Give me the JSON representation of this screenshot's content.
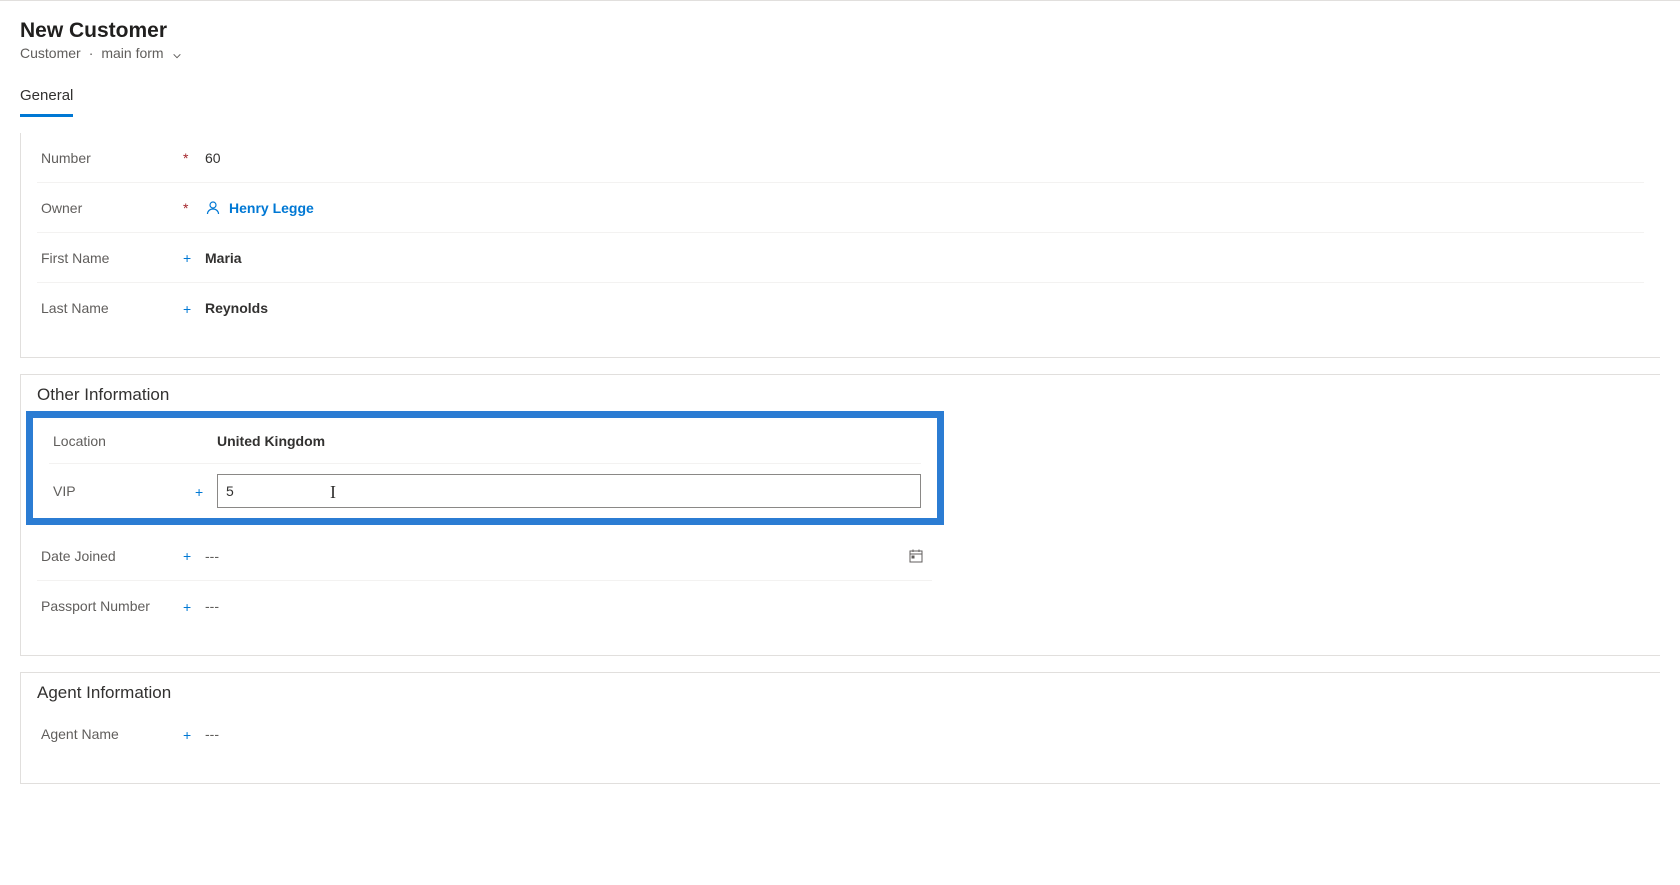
{
  "header": {
    "title": "New Customer",
    "entity": "Customer",
    "form_name": "main form"
  },
  "tabs": {
    "general": "General"
  },
  "fields": {
    "number": {
      "label": "Number",
      "value": "60",
      "required": "red"
    },
    "owner": {
      "label": "Owner",
      "value": "Henry Legge",
      "required": "red"
    },
    "first_name": {
      "label": "First Name",
      "value": "Maria",
      "required": "blue"
    },
    "last_name": {
      "label": "Last Name",
      "value": "Reynolds",
      "required": "blue"
    }
  },
  "sections": {
    "other_info": {
      "title": "Other Information",
      "location": {
        "label": "Location",
        "value": "United Kingdom"
      },
      "vip": {
        "label": "VIP",
        "value": "5",
        "required": "blue"
      },
      "date_joined": {
        "label": "Date Joined",
        "value": "---",
        "required": "blue"
      },
      "passport": {
        "label": "Passport Number",
        "value": "---",
        "required": "blue"
      }
    },
    "agent_info": {
      "title": "Agent Information",
      "agent_name": {
        "label": "Agent Name",
        "value": "---",
        "required": "blue"
      }
    }
  },
  "colors": {
    "accent": "#0078d4",
    "highlight": "#2b7cd3"
  }
}
